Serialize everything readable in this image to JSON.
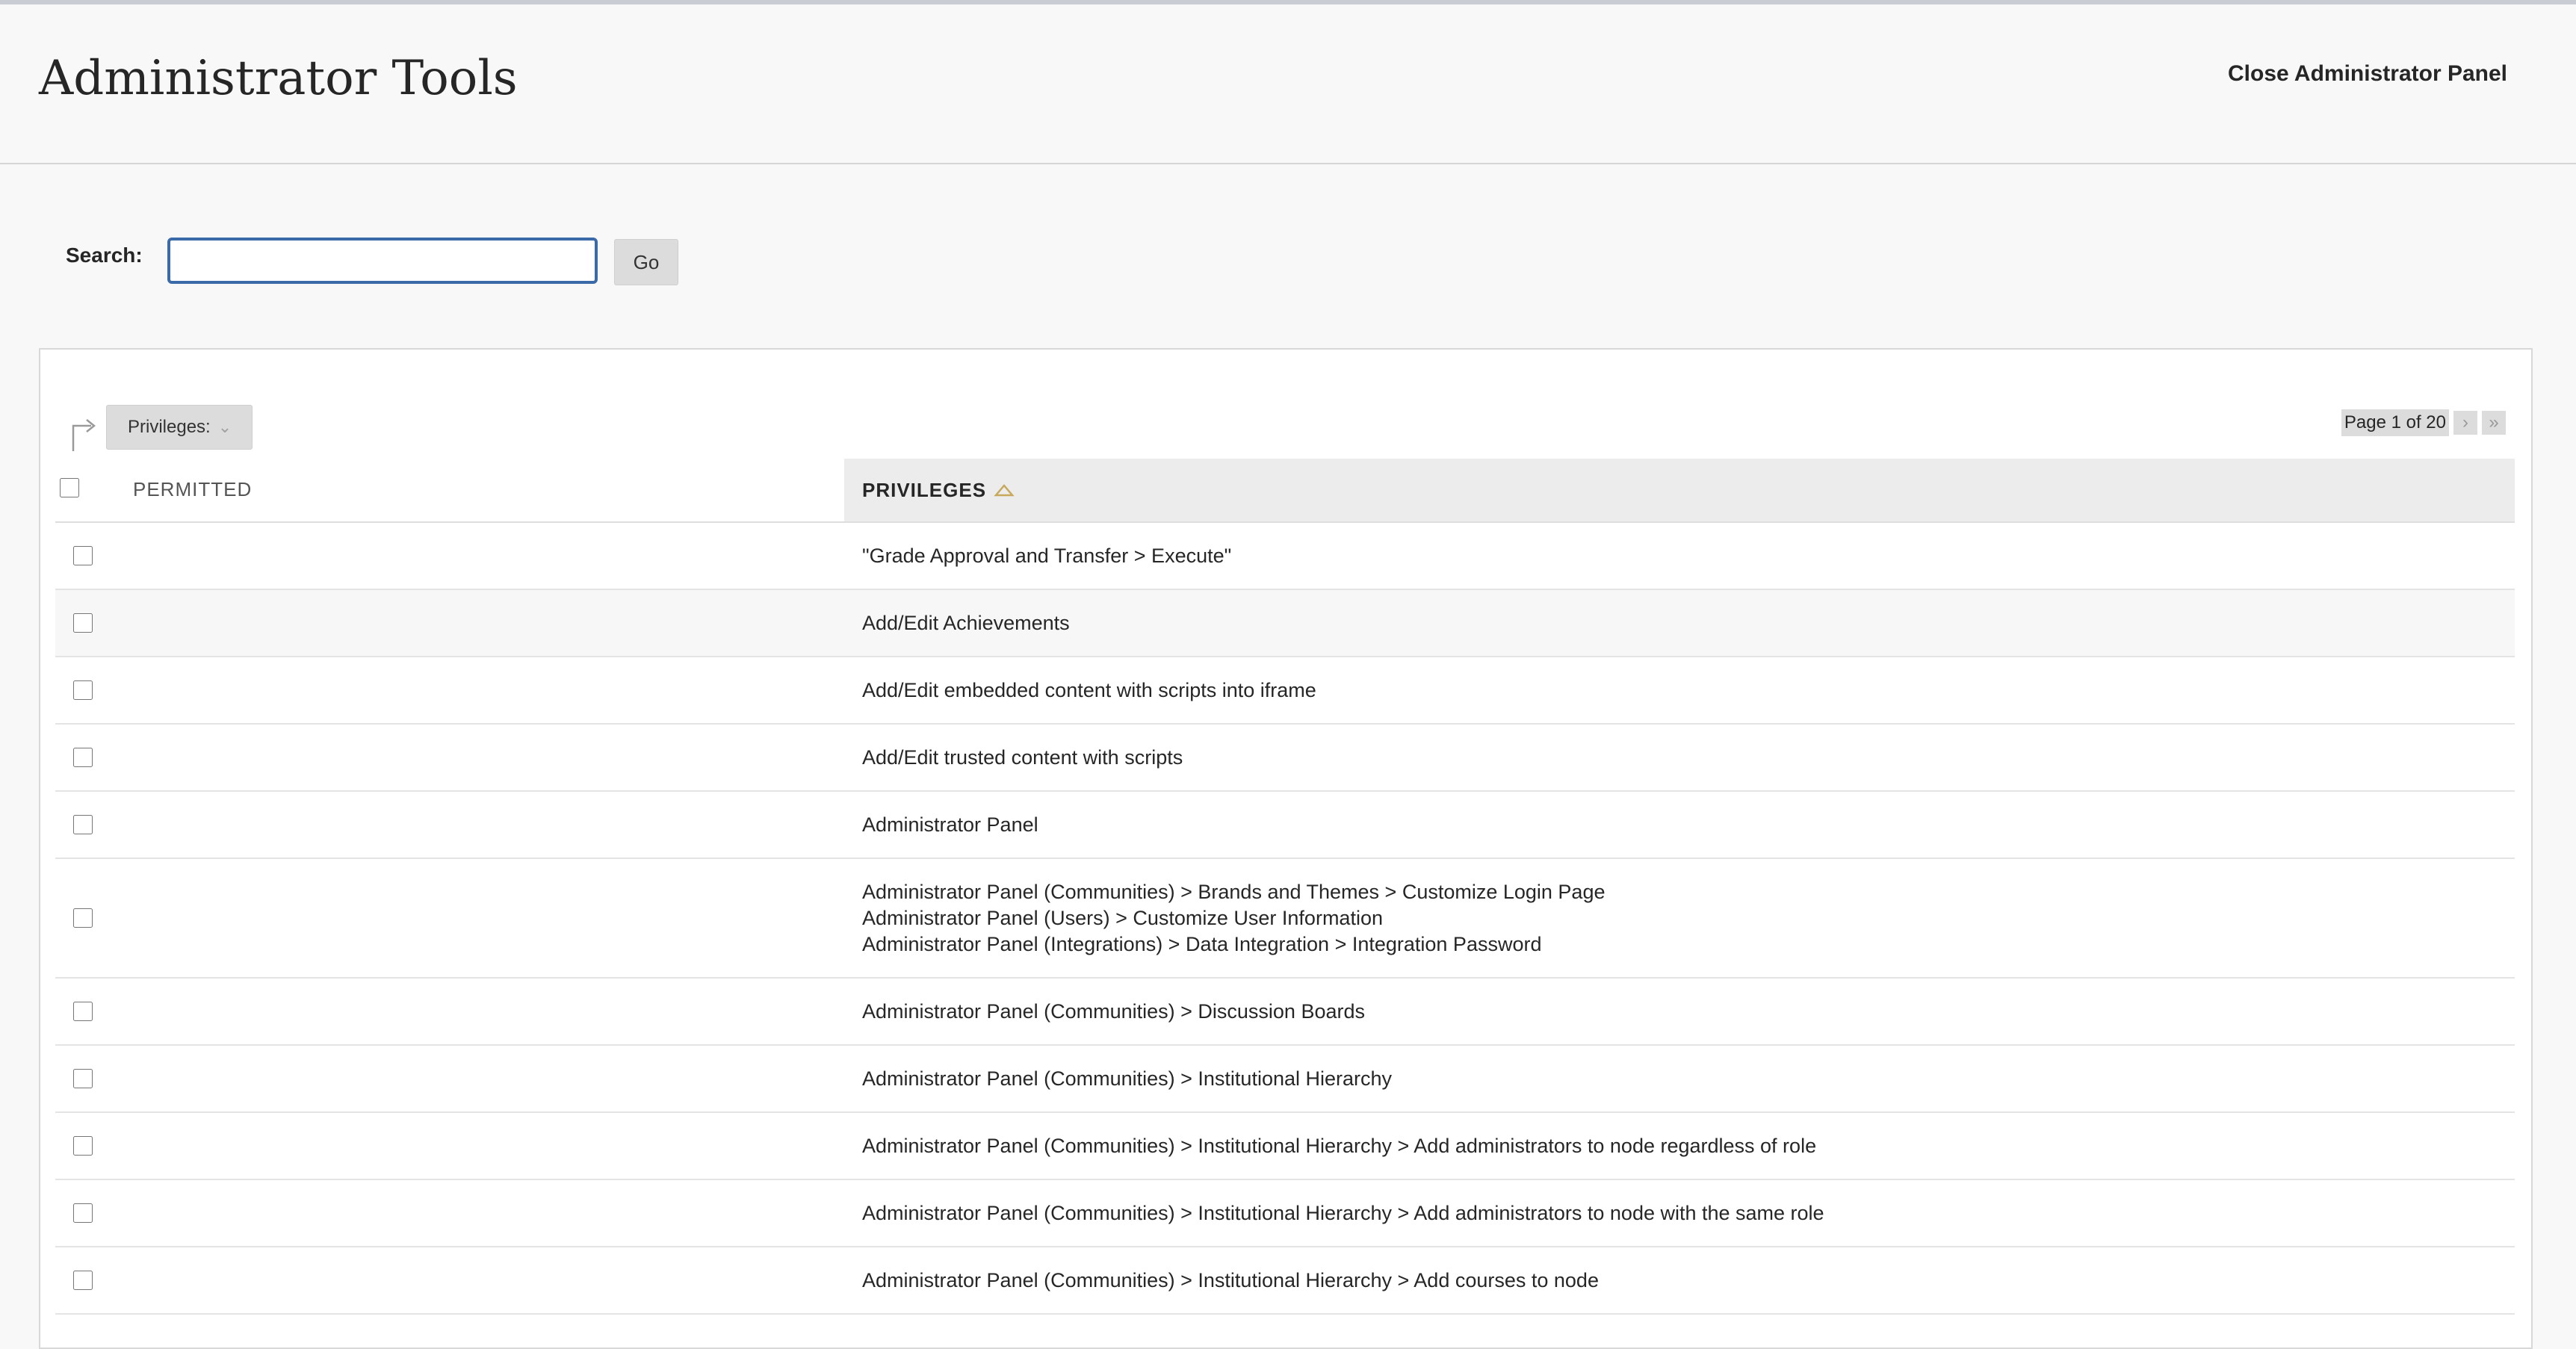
{
  "header": {
    "title": "Administrator Tools",
    "close_label": "Close Administrator Panel"
  },
  "search": {
    "label": "Search:",
    "value": "",
    "go_label": "Go"
  },
  "filter": {
    "label": "Privileges:"
  },
  "pagination": {
    "label": "Page 1 of 20"
  },
  "table": {
    "columns": {
      "permitted": "PERMITTED",
      "privileges": "PRIVILEGES"
    },
    "rows": [
      {
        "lines": [
          "\"Grade Approval and Transfer > Execute\""
        ]
      },
      {
        "lines": [
          "Add/Edit Achievements"
        ]
      },
      {
        "lines": [
          "Add/Edit embedded content with scripts into iframe"
        ]
      },
      {
        "lines": [
          "Add/Edit trusted content with scripts"
        ]
      },
      {
        "lines": [
          "Administrator Panel"
        ]
      },
      {
        "lines": [
          "Administrator Panel (Communities) > Brands and Themes > Customize Login Page",
          "Administrator Panel (Users) > Customize User Information",
          "Administrator Panel (Integrations) > Data Integration > Integration Password"
        ]
      },
      {
        "lines": [
          "Administrator Panel (Communities) > Discussion Boards"
        ]
      },
      {
        "lines": [
          "Administrator Panel (Communities) > Institutional Hierarchy"
        ]
      },
      {
        "lines": [
          "Administrator Panel (Communities) > Institutional Hierarchy > Add administrators to node regardless of role"
        ]
      },
      {
        "lines": [
          "Administrator Panel (Communities) > Institutional Hierarchy > Add administrators to node with the same role"
        ]
      },
      {
        "lines": [
          "Administrator Panel (Communities) > Institutional Hierarchy > Add courses to node"
        ]
      }
    ]
  },
  "colors": {
    "accent": "#3a6aa7",
    "sort_icon": "#c8a85a"
  },
  "icons": {
    "sort": "sort-ascending-icon",
    "filter": "chevron-down-icon",
    "next": "chevron-right-icon",
    "last": "double-chevron-right-icon",
    "bulk": "bulk-action-arrow-icon"
  }
}
